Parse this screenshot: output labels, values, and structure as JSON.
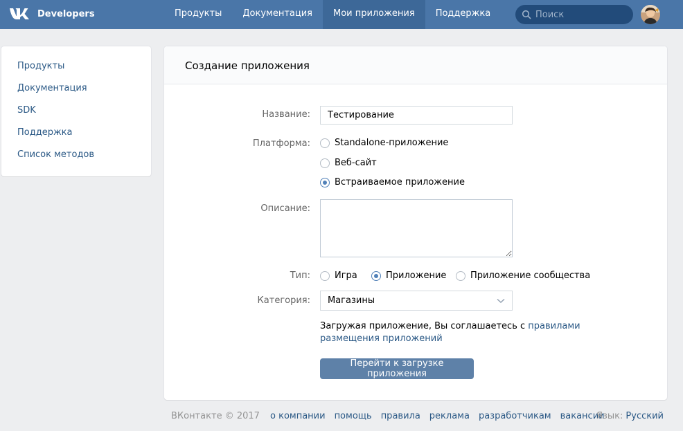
{
  "header": {
    "brand": "Developers",
    "nav": [
      "Продукты",
      "Документация",
      "Мои приложения",
      "Поддержка"
    ],
    "active_nav_index": 2,
    "search_placeholder": "Поиск",
    "colors": {
      "bar": "#4a76a8",
      "active": "#3d6898",
      "search": "#224b7a"
    }
  },
  "sidebar": {
    "items": [
      {
        "label": "Продукты"
      },
      {
        "label": "Документация"
      },
      {
        "label": "SDK"
      },
      {
        "label": "Поддержка"
      },
      {
        "label": "Список методов"
      }
    ]
  },
  "form": {
    "title": "Создание приложения",
    "name_label": "Название:",
    "name_value": "Тестирование",
    "platform_label": "Платформа:",
    "platforms": [
      {
        "label": "Standalone-приложение",
        "checked": false
      },
      {
        "label": "Веб-сайт",
        "checked": false
      },
      {
        "label": "Встраиваемое приложение",
        "checked": true
      }
    ],
    "description_label": "Описание:",
    "description_value": "",
    "type_label": "Тип:",
    "types": [
      {
        "label": "Игра",
        "checked": false
      },
      {
        "label": "Приложение",
        "checked": true
      },
      {
        "label": "Приложение сообщества",
        "checked": false
      }
    ],
    "category_label": "Категория:",
    "category_value": "Магазины",
    "agree_text": "Загружая приложение, Вы соглашаетесь с ",
    "agree_link": "правилами размещения приложений",
    "submit_label": "Перейти к загрузке приложения"
  },
  "footer": {
    "copyright": "ВКонтакте © 2017",
    "links": [
      "о компании",
      "помощь",
      "правила",
      "реклама",
      "разработчикам",
      "вакансии"
    ],
    "language_label": "Язык:",
    "language_value": "Русский"
  }
}
